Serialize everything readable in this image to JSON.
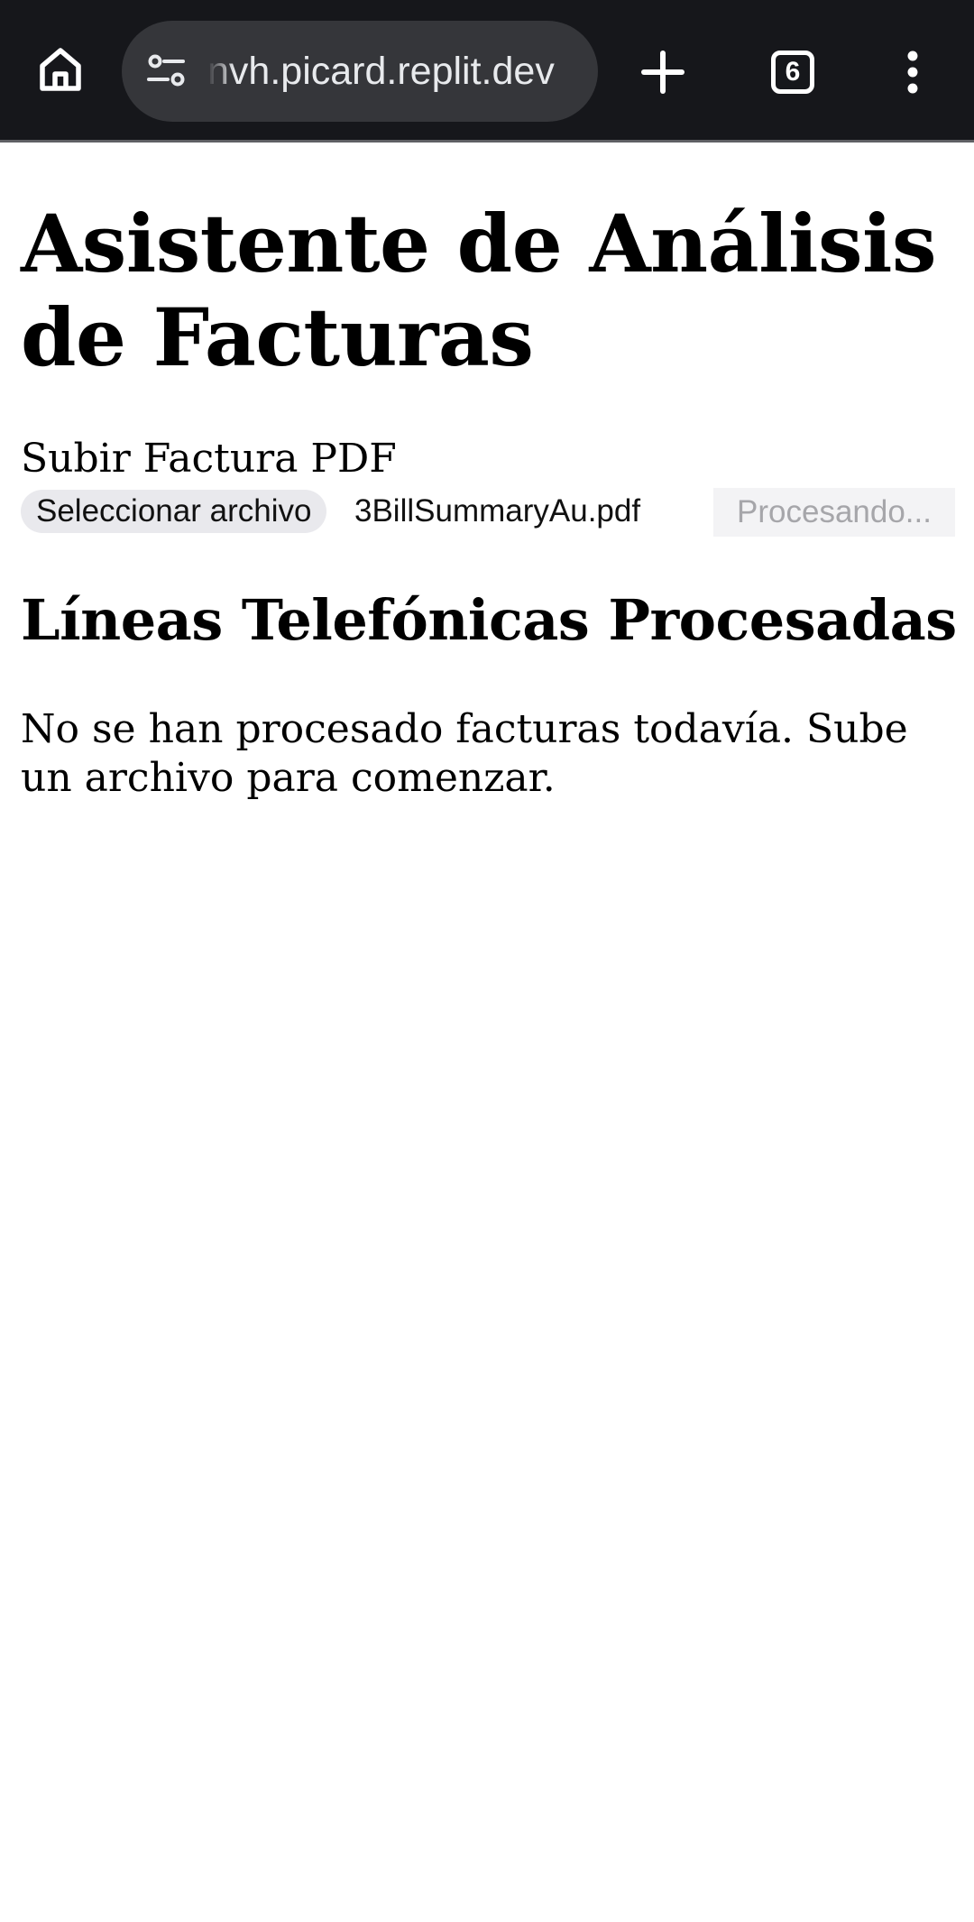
{
  "browser": {
    "url": "nvh.picard.replit.dev",
    "tab_count": "6",
    "icons": {
      "home": "home-icon",
      "site_info": "site-settings-icon",
      "new_tab": "plus-icon",
      "tabs": "tab-switcher-icon",
      "menu": "more-vert-icon"
    },
    "colors": {
      "toolbar": "#16171b",
      "omnibox": "#35363a",
      "text": "#e8eaed"
    }
  },
  "page": {
    "title": "Asistente de Análisis de Facturas",
    "upload": {
      "label": "Subir Factura PDF",
      "choose_button": "Seleccionar archivo",
      "file_name": "3BillSummaryAu.pdf",
      "process_button": "Procesando..."
    },
    "lines_section": {
      "title": "Líneas Telefónicas Procesadas",
      "empty_message": "No se han procesado facturas todavía. Sube un archivo para comenzar."
    }
  }
}
